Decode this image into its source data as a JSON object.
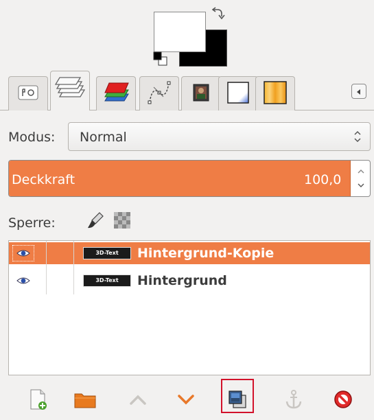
{
  "colors": {
    "foreground": "#ffffff",
    "background": "#000000",
    "accent": "#ef7d45",
    "highlight_border": "#d2112a"
  },
  "color_area": {
    "swap_icon": "swap-colors-icon",
    "reset_icon": "reset-colors-icon"
  },
  "tabs": [
    {
      "name": "tool-options-tab",
      "icon": "tool-options-icon",
      "active": false
    },
    {
      "name": "layers-tab",
      "icon": "layers-icon",
      "active": true
    },
    {
      "name": "channels-tab",
      "icon": "channels-icon",
      "active": false
    },
    {
      "name": "paths-tab",
      "icon": "paths-icon",
      "active": false
    },
    {
      "name": "images-tab",
      "icon": "image-thumbnail-icon",
      "active": false
    },
    {
      "name": "brushes-tab",
      "icon": "white-gradient-icon",
      "active": false
    },
    {
      "name": "gradients-tab",
      "icon": "orange-gradient-icon",
      "active": false
    }
  ],
  "mode": {
    "label": "Modus:",
    "value": "Normal"
  },
  "opacity": {
    "label": "Deckkraft",
    "value": "100,0",
    "fill_fraction": 1.0
  },
  "lock": {
    "label": "Sperre:",
    "icons": [
      "lock-pixels-brush-icon",
      "lock-alpha-checker-icon"
    ]
  },
  "layers": [
    {
      "name": "Hintergrund-Kopie",
      "thumb_text": "3D-Text",
      "visible": true,
      "selected": true
    },
    {
      "name": "Hintergrund",
      "thumb_text": "3D-Text",
      "visible": true,
      "selected": false
    }
  ],
  "toolbar": [
    "new-layer-icon",
    "new-layer-group-icon",
    "raise-layer-icon",
    "lower-layer-icon",
    "duplicate-layer-icon",
    "anchor-layer-icon",
    "delete-layer-icon"
  ]
}
